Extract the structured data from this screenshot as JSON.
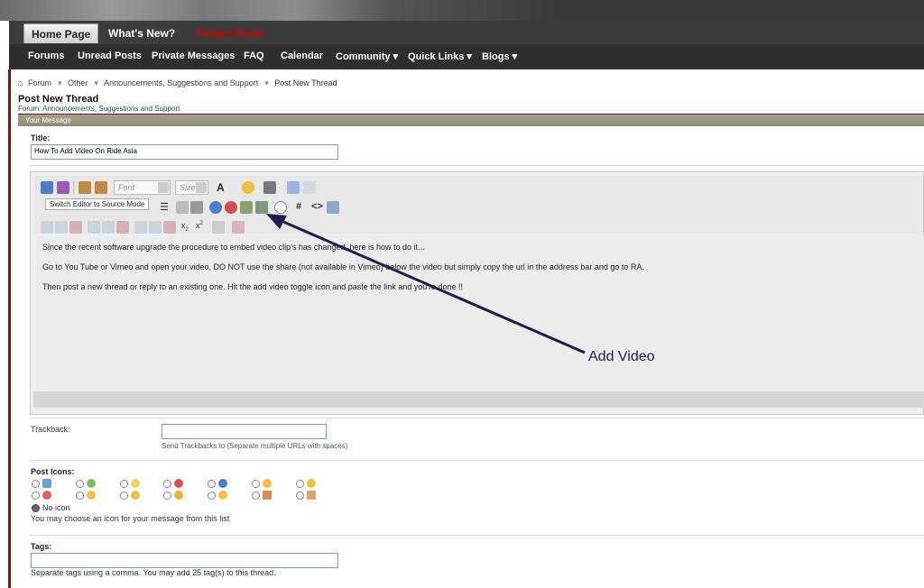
{
  "nav_primary": [
    "Home Page",
    "What's New?",
    "Todays Posts"
  ],
  "nav_secondary": [
    "Forums",
    "Unread Posts",
    "Private Messages",
    "FAQ",
    "Calendar",
    "Community ▾",
    "Quick Links ▾",
    "Blogs ▾"
  ],
  "breadcrumb": [
    "Forum",
    "Other",
    "Announcements, Suggestions and Support",
    "Post New Thread"
  ],
  "page_title": "Post New Thread",
  "forum_line": "Forum: Announcements, Suggestions and Support",
  "block_title": "Your Message",
  "title_label": "Title:",
  "title_value": "How To Add Video On Ride Asia",
  "toolbar": {
    "font_placeholder": "Font",
    "size_placeholder": "Size",
    "tooltip": "Switch Editor to Source Mode"
  },
  "editor_lines": [
    "Since the recent software upgrade the procedure to embed video clip's has changed, here is how to do it...",
    "Go to You Tube or Vimeo and open your video, DO NOT use the share (not available in Vimeo) below the video but simply copy the url in the address bar and go to RA.",
    "Then post a new thread or reply to an existing one. Hit the add video toggle icon and paste the link and you're done !!"
  ],
  "annotation": "Add Video",
  "trackback": {
    "label": "Trackback:",
    "hint": "Send Trackbacks to (Separate multiple URLs with spaces)"
  },
  "post_icons": {
    "label": "Post Icons:",
    "no_icon": "No icon",
    "hint": "You may choose an icon for your message from this list"
  },
  "tags": {
    "label": "Tags:",
    "hint": "Separate tags using a comma. You may add 25 tag(s) to this thread."
  },
  "colors": {
    "nav_bg": "#3c3c3c",
    "accent_red": "#d40000",
    "link": "#27476a",
    "arrow": "#1d1d50"
  }
}
